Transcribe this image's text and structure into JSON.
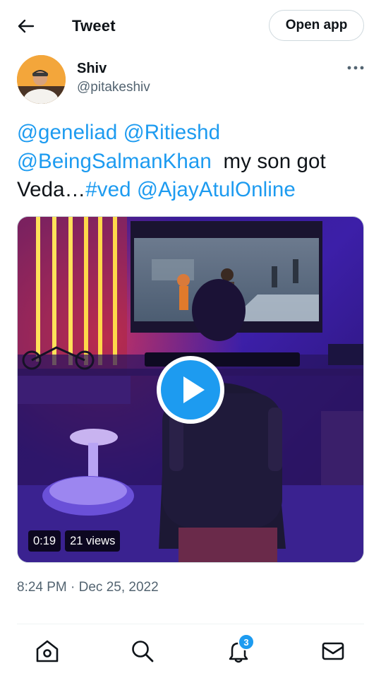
{
  "header": {
    "title": "Tweet",
    "open_app_label": "Open app"
  },
  "author": {
    "name": "Shiv",
    "handle": "@pitakeshiv"
  },
  "tweet": {
    "parts": [
      {
        "text": "@geneliad",
        "type": "mention"
      },
      {
        "text": " ",
        "type": "text"
      },
      {
        "text": "@Ritieshd",
        "type": "mention"
      },
      {
        "text": " ",
        "type": "text"
      },
      {
        "text": "@BeingSalmanKhan",
        "type": "mention"
      },
      {
        "text": "  my son got Veda…",
        "type": "text"
      },
      {
        "text": "#ved",
        "type": "hashtag"
      },
      {
        "text": " ",
        "type": "text"
      },
      {
        "text": "@AjayAtulOnline",
        "type": "mention"
      }
    ],
    "timestamp": "8:24 PM · Dec 25, 2022"
  },
  "video": {
    "duration": "0:19",
    "views": "21 views"
  },
  "bottom_nav": {
    "notification_count": "3",
    "items": [
      "home-icon",
      "search-icon",
      "bell-icon",
      "mail-icon"
    ]
  },
  "colors": {
    "accent": "#1d9bf0",
    "text": "#0f1419",
    "secondary": "#536471"
  }
}
